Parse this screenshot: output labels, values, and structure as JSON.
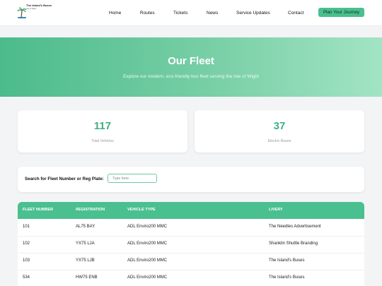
{
  "header": {
    "logo_title": "The Island's Buses",
    "logo_subtitle": "Isle of Wight",
    "nav": [
      {
        "label": "Home"
      },
      {
        "label": "Routes"
      },
      {
        "label": "Tickets"
      },
      {
        "label": "News"
      },
      {
        "label": "Service Updates"
      },
      {
        "label": "Contact"
      }
    ],
    "cta_label": "Plan Your Journey"
  },
  "hero": {
    "title": "Our Fleet",
    "subtitle": "Explore our modern, eco-friendly bus fleet serving the Isle of Wight"
  },
  "stats": [
    {
      "value": "117",
      "label": "Total Vehicles"
    },
    {
      "value": "37",
      "label": "Electric Buses"
    }
  ],
  "search": {
    "label": "Search for Fleet Number or Reg Plate:",
    "placeholder": "Type here",
    "value": ""
  },
  "table": {
    "columns": [
      "FLEET NUMBER",
      "REGISTRATION",
      "VEHICLE TYPE",
      "LIVERY"
    ],
    "rows": [
      [
        "101",
        "AL75 BAY",
        "ADL Enviro200 MMC",
        "The Needles Advertisement"
      ],
      [
        "102",
        "YX75 LJA",
        "ADL Enviro200 MMC",
        "Shanklin Shuttle Branding"
      ],
      [
        "103",
        "YX75 LJB",
        "ADL Enviro200 MMC",
        "The Island's Buses"
      ],
      [
        "534",
        "HW75 ENB",
        "ADL Enviro200 MMC",
        "The Island's Buses"
      ]
    ]
  },
  "colors": {
    "accent": "#4abf8f",
    "hero_start": "#4cbb8c",
    "hero_end": "#a2e4c4",
    "stat_number": "#3fae82"
  }
}
